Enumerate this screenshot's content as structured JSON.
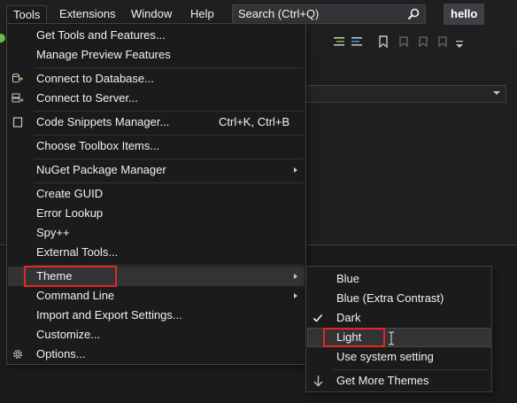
{
  "menubar": {
    "items": [
      {
        "label": "Tools"
      },
      {
        "label": "Extensions"
      },
      {
        "label": "Window"
      },
      {
        "label": "Help"
      }
    ],
    "search_placeholder": "Search (Ctrl+Q)",
    "solution_name": "hello"
  },
  "tools_menu": {
    "items": [
      {
        "label": "Get Tools and Features..."
      },
      {
        "label": "Manage Preview Features"
      },
      {
        "label": "Connect to Database...",
        "icon": "database-connect-icon"
      },
      {
        "label": "Connect to Server...",
        "icon": "server-connect-icon"
      },
      {
        "label": "Code Snippets Manager...",
        "shortcut": "Ctrl+K, Ctrl+B",
        "icon": "snippet-icon"
      },
      {
        "label": "Choose Toolbox Items..."
      },
      {
        "label": "NuGet Package Manager",
        "submenu": true
      },
      {
        "label": "Create GUID"
      },
      {
        "label": "Error Lookup"
      },
      {
        "label": "Spy++"
      },
      {
        "label": "External Tools..."
      },
      {
        "label": "Theme",
        "submenu": true,
        "active": true
      },
      {
        "label": "Command Line",
        "submenu": true
      },
      {
        "label": "Import and Export Settings..."
      },
      {
        "label": "Customize..."
      },
      {
        "label": "Options...",
        "icon": "gear-icon"
      }
    ]
  },
  "theme_menu": {
    "items": [
      {
        "label": "Blue"
      },
      {
        "label": "Blue (Extra Contrast)"
      },
      {
        "label": "Dark",
        "checked": true
      },
      {
        "label": "Light",
        "hovered": true
      },
      {
        "label": "Use system setting"
      },
      {
        "label": "Get More Themes",
        "icon": "download-icon"
      }
    ]
  },
  "colors": {
    "background": "#1e1e1e",
    "menu_background": "#1b1b1c",
    "highlight_red": "#e0262a",
    "text": "#f1f1f1"
  }
}
